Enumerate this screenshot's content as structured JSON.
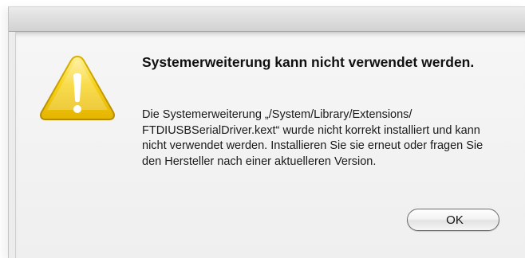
{
  "dialog": {
    "title": "Systemerweiterung kann nicht verwendet werden.",
    "message": "Die Systemerweiterung „/System/Library/Extensions/ FTDIUSBSerialDriver.kext“ wurde nicht korrekt installiert und kann nicht verwendet werden. Installieren Sie sie erneut oder fragen Sie den Hersteller nach einer aktuelleren Version.",
    "icon": "warning-triangle-icon",
    "ok_label": "OK"
  },
  "colors": {
    "warning_yellow": "#f7d21a",
    "window_background": "#ececec"
  }
}
